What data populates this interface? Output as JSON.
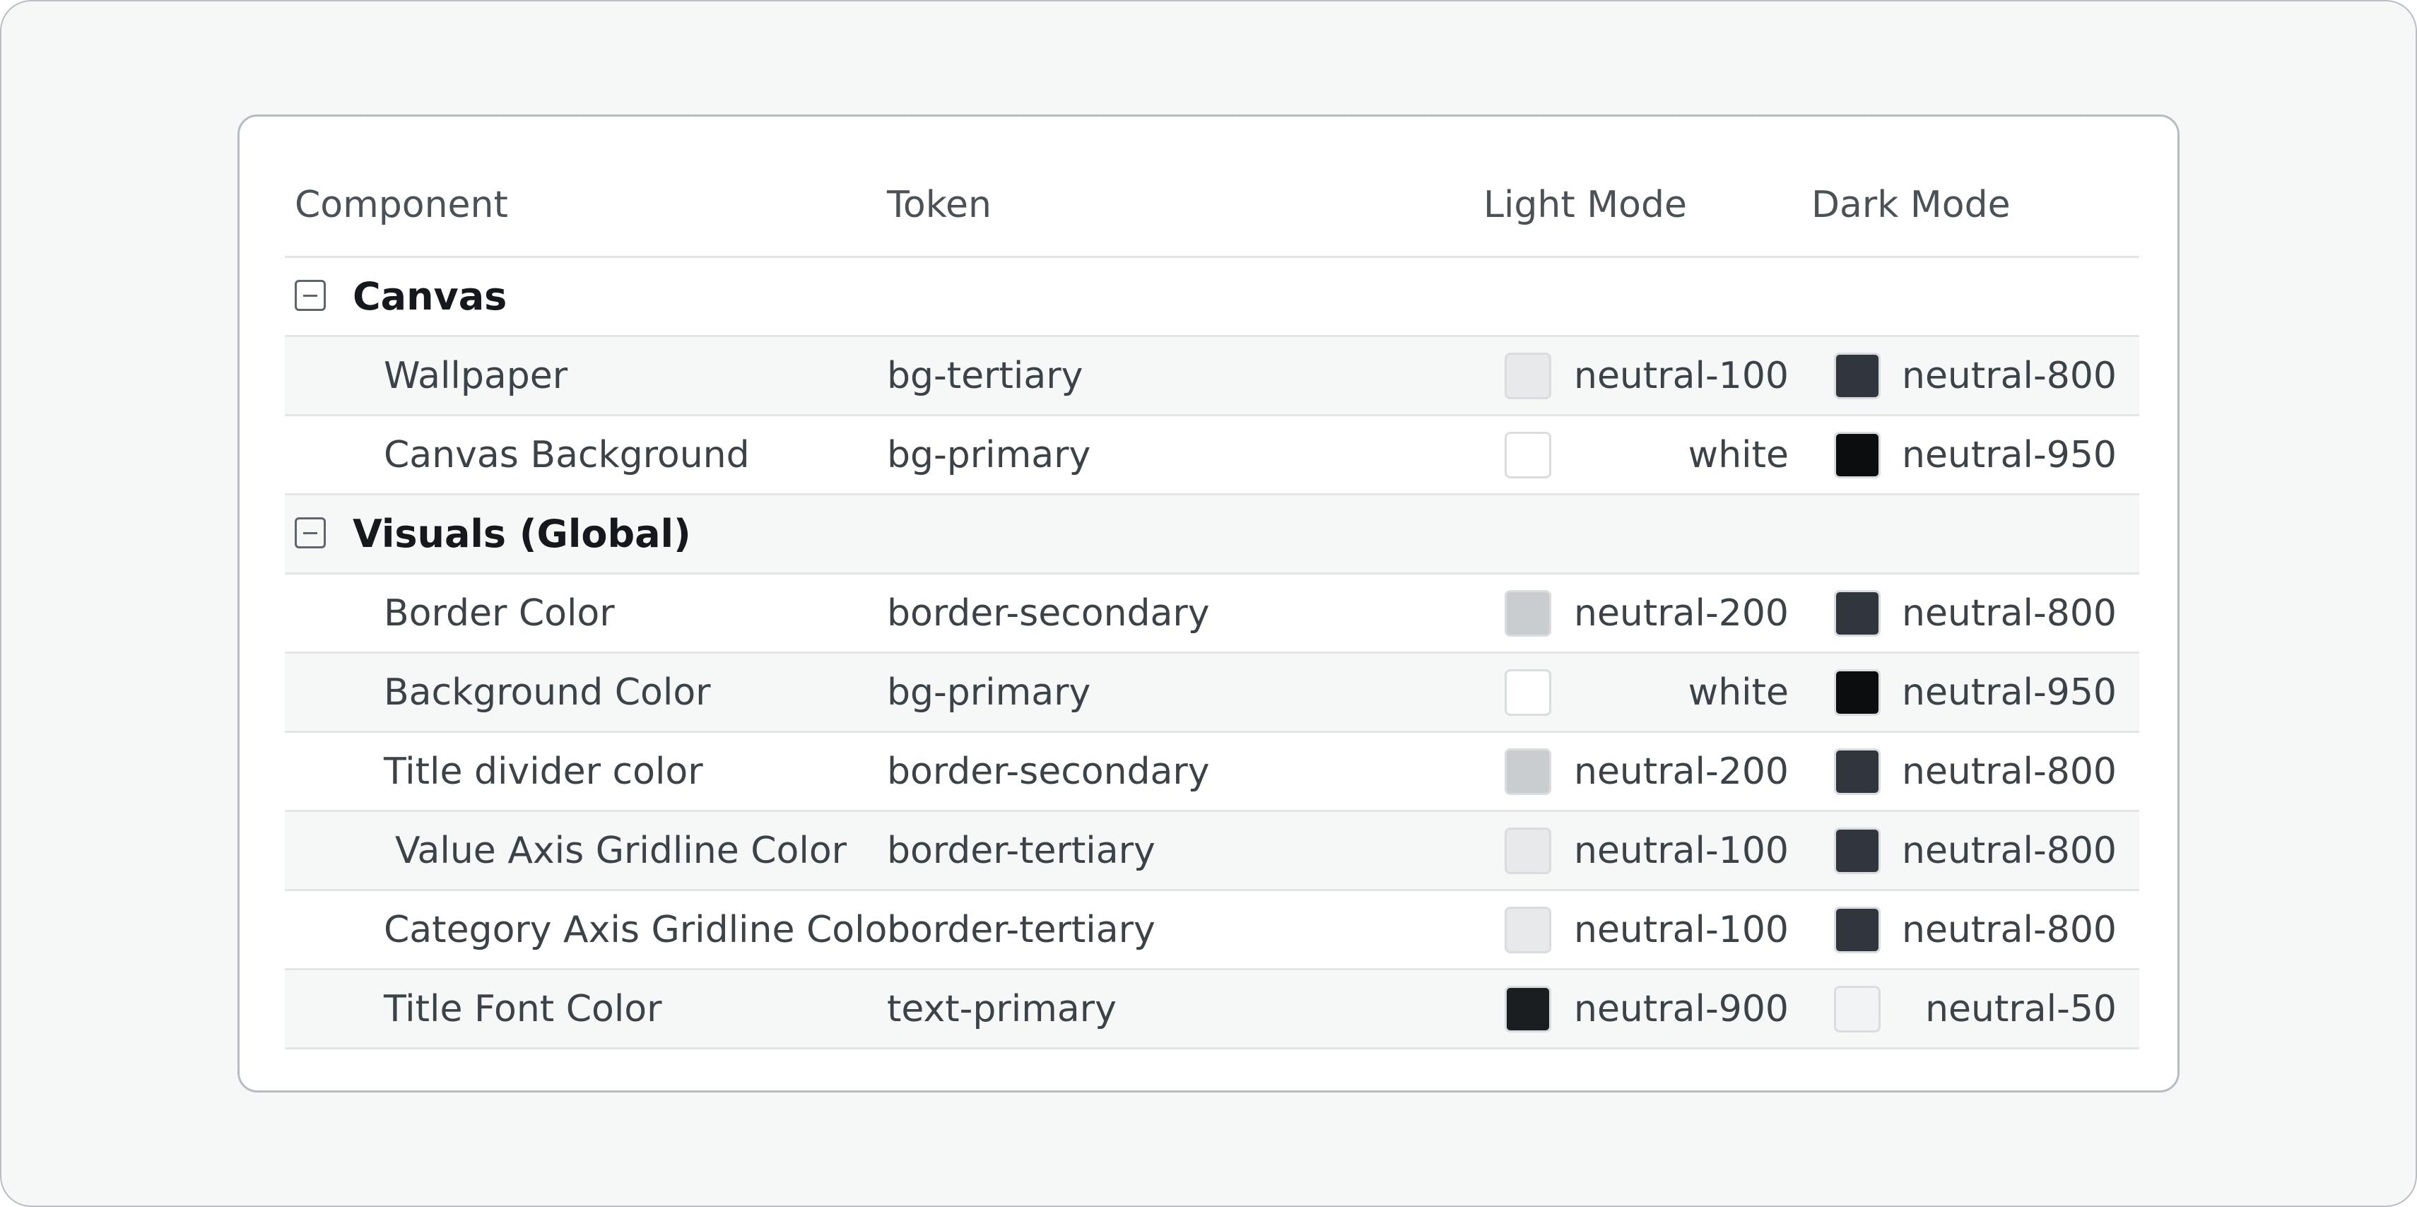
{
  "columns": {
    "component": "Component",
    "token": "Token",
    "light": "Light Mode",
    "dark": "Dark Mode"
  },
  "groups": [
    {
      "title": "Canvas",
      "rows": [
        {
          "component": "Wallpaper",
          "token": "bg-tertiary",
          "light": "neutral-100",
          "light_color": "#e7e9eb",
          "dark": "neutral-800",
          "dark_color": "#30363b"
        },
        {
          "component": "Canvas Background",
          "token": "bg-primary",
          "light": "white",
          "light_color": "#ffffff",
          "dark": "neutral-950",
          "dark_color": "#0b0d0e"
        }
      ]
    },
    {
      "title": "Visuals (Global)",
      "rows": [
        {
          "component": "Border Color",
          "token": "border-secondary",
          "light": "neutral-200",
          "light_color": "#c9cdd0",
          "dark": "neutral-800",
          "dark_color": "#30363b"
        },
        {
          "component": "Background Color",
          "token": "bg-primary",
          "light": "white",
          "light_color": "#ffffff",
          "dark": "neutral-950",
          "dark_color": "#0b0d0e"
        },
        {
          "component": "Title divider color",
          "token": "border-secondary",
          "light": "neutral-200",
          "light_color": "#c9cdd0",
          "dark": "neutral-800",
          "dark_color": "#30363b"
        },
        {
          "component": "Value Axis Gridline Color",
          "token": "border-tertiary",
          "light": "neutral-100",
          "light_color": "#e7e9eb",
          "dark": "neutral-800",
          "dark_color": "#30363b"
        },
        {
          "component": "Category Axis Gridline Color",
          "token": "border-tertiary",
          "light": "neutral-100",
          "light_color": "#e7e9eb",
          "dark": "neutral-800",
          "dark_color": "#30363b"
        },
        {
          "component": "Title Font Color",
          "token": "text-primary",
          "light": "neutral-900",
          "light_color": "#1a1e21",
          "dark": "neutral-50",
          "dark_color": "#f2f3f4"
        }
      ]
    }
  ]
}
